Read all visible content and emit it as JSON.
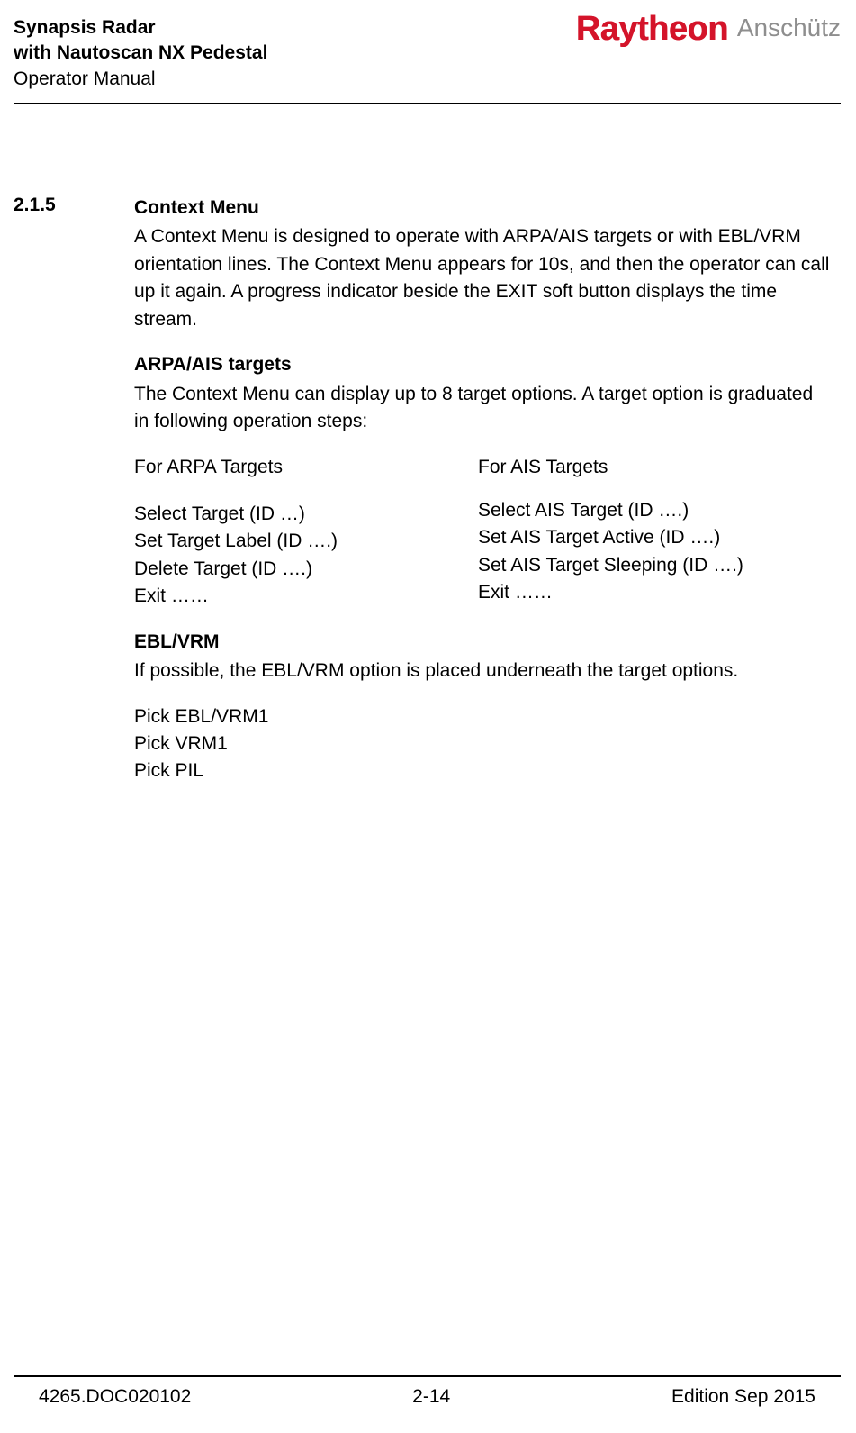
{
  "header": {
    "line1": "Synapsis Radar",
    "line2": "with Nautoscan NX Pedestal",
    "line3": "Operator Manual",
    "logo_raytheon": "Raytheon",
    "logo_anschutz": "Anschütz"
  },
  "section": {
    "number": "2.1.5",
    "title": "Context Menu",
    "intro": "A Context Menu is designed to operate with ARPA/AIS targets or with EBL/VRM orientation lines. The Context Menu appears for 10s, and then the operator can call up it again. A progress indicator beside the EXIT soft button displays the time stream.",
    "arpa": {
      "heading": "ARPA/AIS targets",
      "text": "The Context Menu can display up to 8 target options. A target option is graduated in following operation steps:",
      "col_left_head": "For ARPA Targets",
      "col_left_items": [
        "Select Target (ID …)",
        "Set Target Label (ID ….)",
        "Delete Target (ID ….)",
        "Exit ……"
      ],
      "col_right_head": "For AIS Targets",
      "col_right_items": [
        "Select AIS Target (ID ….)",
        "Set AIS Target Active (ID ….)",
        "Set AIS Target Sleeping (ID ….)",
        "Exit ……"
      ]
    },
    "ebl": {
      "heading": "EBL/VRM",
      "text": "If possible, the EBL/VRM option is placed underneath the target options.",
      "items": [
        "Pick EBL/VRM1",
        "Pick VRM1",
        "Pick PIL"
      ]
    }
  },
  "footer": {
    "left": "4265.DOC020102",
    "center": "2-14",
    "right": "Edition Sep 2015"
  }
}
